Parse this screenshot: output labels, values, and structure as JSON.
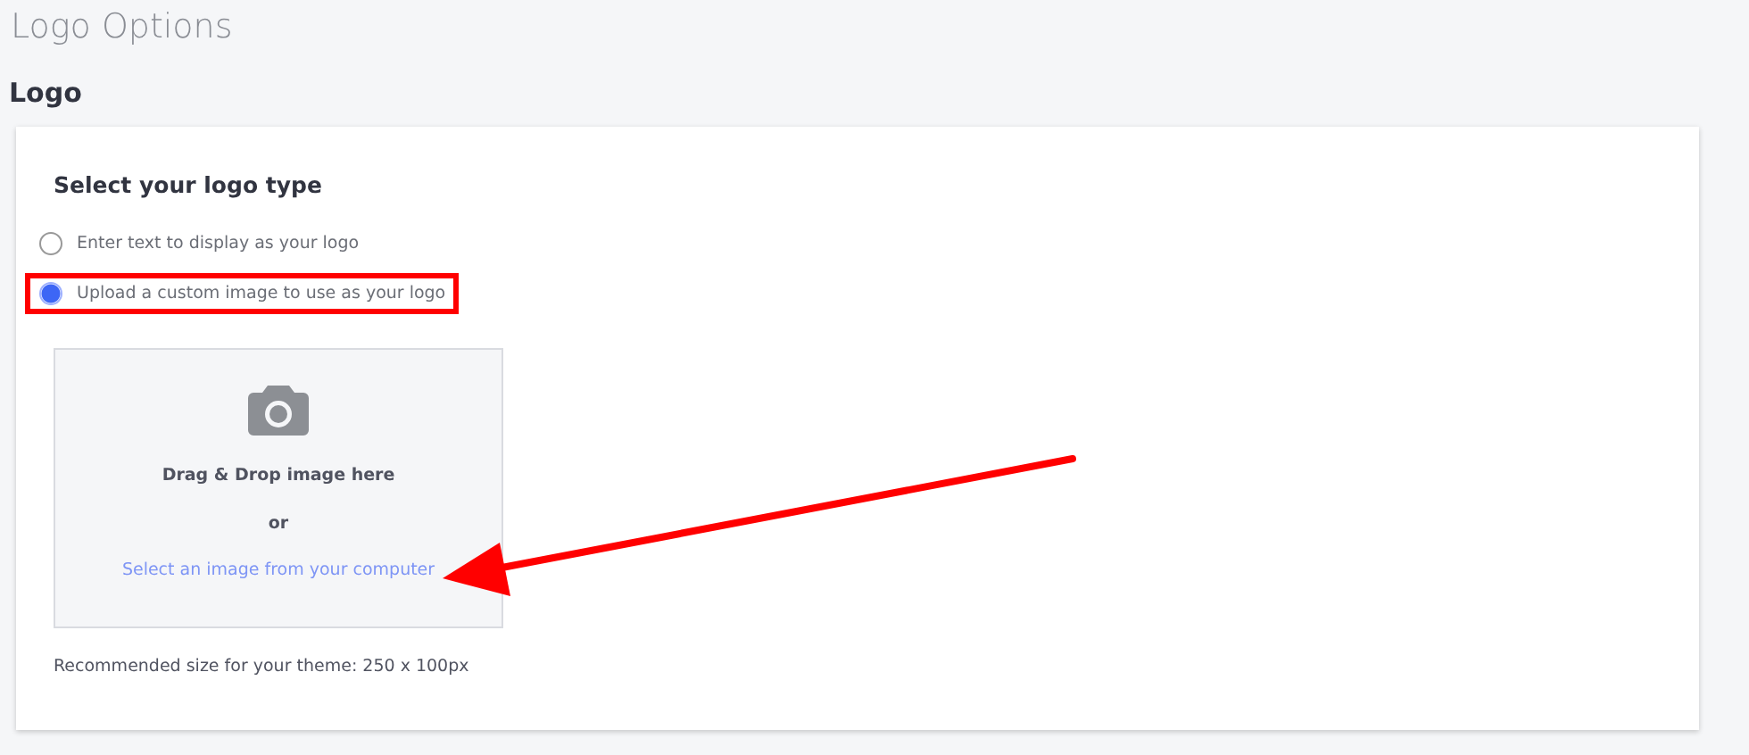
{
  "page_title": "Logo Options",
  "section_title": "Logo",
  "card": {
    "heading": "Select your logo type",
    "options": [
      {
        "label": "Enter text to display as your logo",
        "selected": false,
        "highlighted": false
      },
      {
        "label": "Upload a custom image to use as your logo",
        "selected": true,
        "highlighted": true
      }
    ],
    "dropzone": {
      "prompt": "Drag & Drop image here",
      "separator": "or",
      "link": "Select an image from your computer"
    },
    "hint": "Recommended size for your theme: 250 x 100px"
  }
}
